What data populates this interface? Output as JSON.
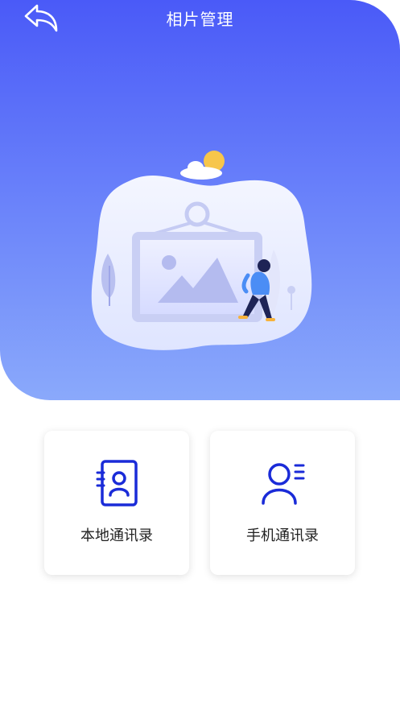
{
  "header": {
    "title": "相片管理",
    "back_icon": "back-arrow-icon"
  },
  "hero": {
    "illustration": "photo-frame-illustration",
    "gradient_top": "#4a5af8",
    "gradient_bottom": "#8aa9fb"
  },
  "cards": [
    {
      "label": "本地通讯录",
      "icon": "contact-book-icon"
    },
    {
      "label": "手机通讯录",
      "icon": "person-list-icon"
    }
  ],
  "colors": {
    "accent": "#1a2bd8",
    "card_bg": "#ffffff",
    "text": "#222222"
  }
}
